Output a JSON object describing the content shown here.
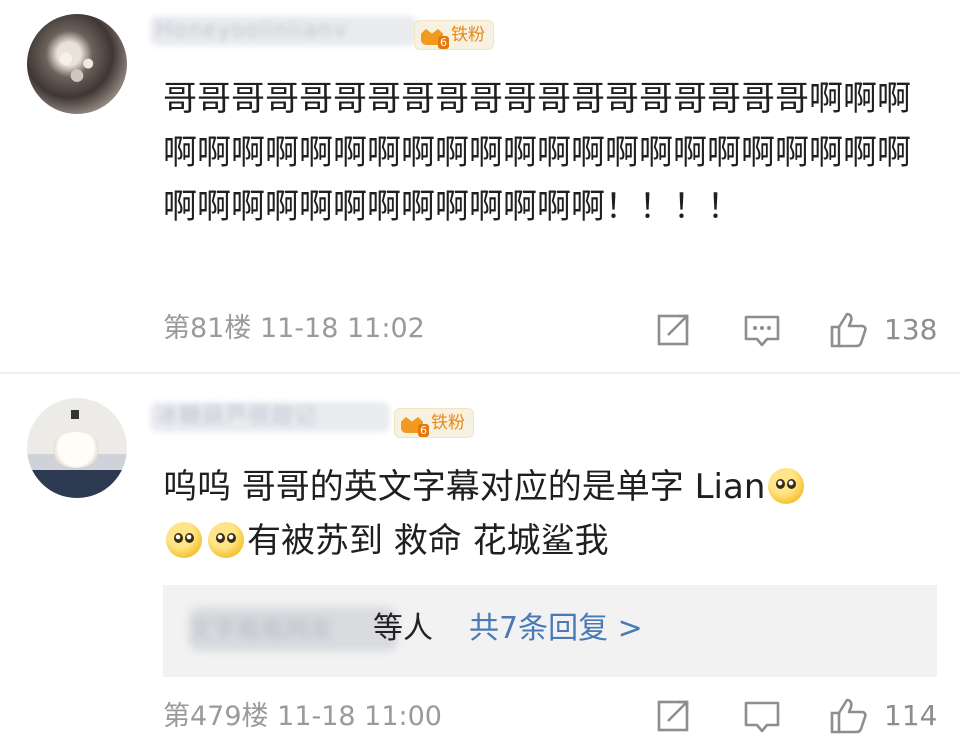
{
  "comments": [
    {
      "username": "Honeyoolinlianv",
      "badge": {
        "level": "6",
        "label": "铁粉"
      },
      "text": "哥哥哥哥哥哥哥哥哥哥哥哥哥哥哥哥哥哥哥啊啊啊啊啊啊啊啊啊啊啊啊啊啊啊啊啊啊啊啊啊啊啊啊啊啊啊啊啊啊啊啊啊啊啊啊啊啊！！！！",
      "floor": "第81楼",
      "time": "11-18 11:02",
      "likes": "138"
    },
    {
      "username": "冰糖葫芦很甜记",
      "badge": {
        "level": "6",
        "label": "铁粉"
      },
      "text_before": "呜呜 哥哥的英文字幕对应的是单字 Lian",
      "text_after": "有被苏到 救命 花城鲨我",
      "emojis": [
        "pleading-face",
        "pleading-face",
        "pleading-face"
      ],
      "reply_summary": {
        "names": "文字瓶瓶网友",
        "etc": "等人",
        "link": "共7条回复 >"
      },
      "floor": "第479楼",
      "time": "11-18 11:00",
      "likes": "114"
    }
  ],
  "icons": {
    "share": "share-icon",
    "reply": "comment-icon",
    "like": "thumbs-up-icon"
  },
  "colors": {
    "link": "#4a7ab6",
    "meta": "#9a9a9a",
    "badge": "#f29a1f"
  }
}
